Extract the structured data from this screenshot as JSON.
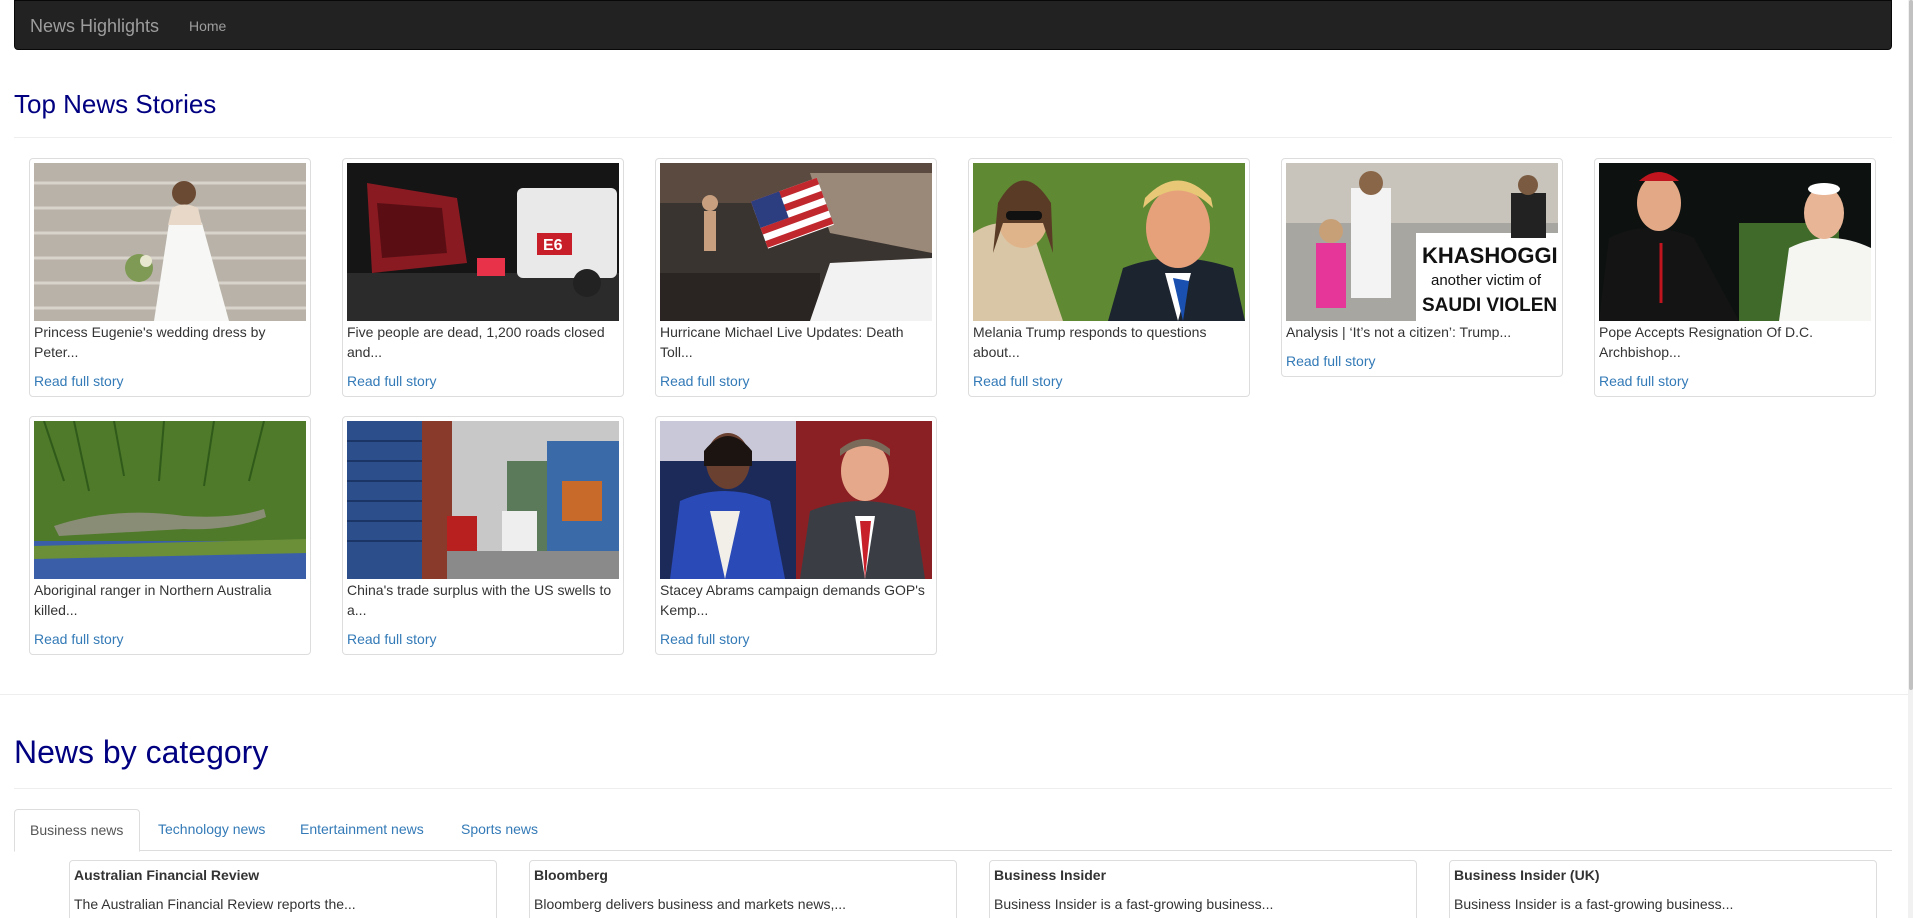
{
  "navbar": {
    "brand": "News Highlights",
    "home": "Home"
  },
  "top_stories": {
    "heading": "Top News Stories",
    "read_label": "Read full story",
    "items": [
      {
        "title": "Princess Eugenie's wedding dress by Peter..."
      },
      {
        "title": "Five people are dead, 1,200 roads closed and..."
      },
      {
        "title": "Hurricane Michael Live Updates: Death Toll..."
      },
      {
        "title": "Melania Trump responds to questions about..."
      },
      {
        "title": "Analysis | ‘It’s not a citizen’: Trump..."
      },
      {
        "title": "Pope Accepts Resignation Of D.C. Archbishop..."
      },
      {
        "title": "Aboriginal ranger in Northern Australia killed..."
      },
      {
        "title": "China's trade surplus with the US swells to a..."
      },
      {
        "title": "Stacey Abrams campaign demands GOP's Kemp..."
      }
    ]
  },
  "category": {
    "heading": "News by category",
    "tabs": [
      {
        "label": "Business news"
      },
      {
        "label": "Technology news"
      },
      {
        "label": "Entertainment news"
      },
      {
        "label": "Sports news"
      }
    ],
    "sources": [
      {
        "name": "Australian Financial Review",
        "desc": "The Australian Financial Review reports the..."
      },
      {
        "name": "Bloomberg",
        "desc": "Bloomberg delivers business and markets news,..."
      },
      {
        "name": "Business Insider",
        "desc": "Business Insider is a fast-growing business..."
      },
      {
        "name": "Business Insider (UK)",
        "desc": "Business Insider is a fast-growing business..."
      }
    ]
  },
  "sign_text": {
    "line1": "KHASHOGGI:",
    "line2": "another victim of",
    "line3": "SAUDI VIOLENCE"
  },
  "truck_label": "E6",
  "colors": {
    "heading": "#000080",
    "link": "#337ab7",
    "navbar": "#222222"
  }
}
